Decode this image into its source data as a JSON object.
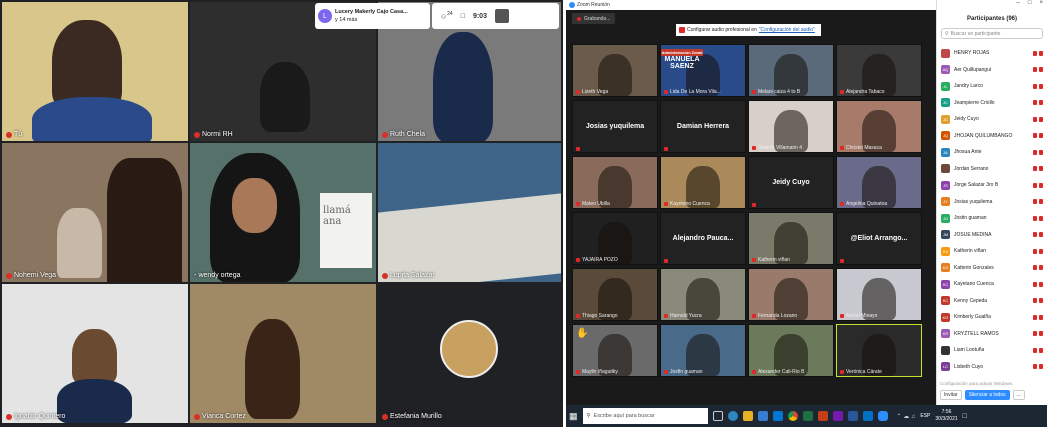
{
  "meet": {
    "notification": {
      "name": "Lucery Makerly Cajo Casa...",
      "sub": "y 14 más"
    },
    "topbar": {
      "count": "24",
      "time": "9:03"
    },
    "tiles": [
      {
        "name": "Tú",
        "bg": "#c8b87a"
      },
      {
        "name": "Normi RH",
        "bg": "#3a3a3a"
      },
      {
        "name": "Ruth Chela",
        "bg": "#6a6a6a"
      },
      {
        "name": "Nohemi Vega",
        "bg": "#7a6a5a"
      },
      {
        "name": "wendy ortega",
        "bg": "#4a6a6a"
      },
      {
        "name": "Lupita Salazar",
        "bg": "#3b5a7a"
      },
      {
        "name": "Ignacio Quintero",
        "bg": "#dcdcdc"
      },
      {
        "name": "Vianca Cortez",
        "bg": "#8a7a60"
      },
      {
        "name": "Estefania Murillo",
        "bg": "#202124"
      }
    ],
    "whiteboard_text": "llamá ana"
  },
  "zoom": {
    "title": "Zoom Reunión",
    "recording": "Grabando...",
    "banner_pre": "Configurar audio profesional en ",
    "banner_link": "\"Configuración del audio\"",
    "sign": {
      "line1": "Administración Zonal",
      "line2": "MANUELA",
      "line3": "SAENZ"
    },
    "tiles": [
      {
        "label": "Lizeth Vega",
        "video": true,
        "bg": "#6b5b4b"
      },
      {
        "label": "Lida De La Mora Vila...",
        "video": true,
        "bg": "#2a4b8a"
      },
      {
        "label": "Melani caiza 4 to B",
        "video": true,
        "bg": "#5a6a7a"
      },
      {
        "label": "Alejandra Tabaco",
        "video": true,
        "bg": "#3a3a3a"
      },
      {
        "label": "",
        "big": "Josias yuquilema"
      },
      {
        "label": "",
        "big": "Damian Herrera"
      },
      {
        "label": "Sharick Villamarin 4",
        "video": true,
        "bg": "#d8d0c8"
      },
      {
        "label": "Christel Masaca",
        "video": true,
        "bg": "#a87a6a"
      },
      {
        "label": "Mateo Ubilla",
        "video": true,
        "bg": "#8a6a5a"
      },
      {
        "label": "Kayetano Cuenca",
        "video": true,
        "bg": "#aa8a5a"
      },
      {
        "label": "",
        "big": "Jeidy  Cuyo"
      },
      {
        "label": "Angelina Quinatoa",
        "video": true,
        "bg": "#6a6a8a"
      },
      {
        "label": "YAJAIRA POZO",
        "video": true,
        "bg": "#202020"
      },
      {
        "label": "",
        "big": "Alejandro  Pauca..."
      },
      {
        "label": "Katherin viñan",
        "video": true,
        "bg": "#7a7a6a"
      },
      {
        "label": "",
        "big": "@Eliot  Arrango..."
      },
      {
        "label": "Thiago Sarango",
        "video": true,
        "bg": "#5a4a3a"
      },
      {
        "label": "Harnold Yucra",
        "video": true,
        "bg": "#8a8a7a"
      },
      {
        "label": "Fernanda Lozano",
        "video": true,
        "bg": "#9a7a6a"
      },
      {
        "label": "Ainhel Minayo",
        "video": true,
        "bg": "#c8c8d0"
      },
      {
        "label": "Maylin Iñaguitky",
        "video": true,
        "bg": "#6a6a6a",
        "thumb": true
      },
      {
        "label": "Josfin guaman",
        "video": true,
        "bg": "#4a6a8a"
      },
      {
        "label": "Alexander Cali-Rio B",
        "video": true,
        "bg": "#6a7a5a"
      },
      {
        "label": "Verónica Cárate",
        "video": true,
        "bg": "#2a2a2a",
        "active": true
      }
    ]
  },
  "participants": {
    "title": "Participantes (96)",
    "search_placeholder": "Buscar un participante",
    "list": [
      {
        "initials": "",
        "name": "HENRY ROJAS",
        "color": "#c04848",
        "photo": true
      },
      {
        "initials": "AQ",
        "name": "Aer Quillupangui",
        "color": "#9b59b6"
      },
      {
        "initials": "JL",
        "name": "Jandry Larco",
        "color": "#27ae60"
      },
      {
        "initials": "JC",
        "name": "Jeampierre Criollo",
        "color": "#16a085"
      },
      {
        "initials": "JC",
        "name": "Jeidy  Cuyo",
        "color": "#e0a030"
      },
      {
        "initials": "JQ",
        "name": "JHOJAN  QUILUMBANGO",
        "color": "#d35400"
      },
      {
        "initials": "JA",
        "name": "Jhosua Ante",
        "color": "#2e86c1"
      },
      {
        "initials": "",
        "name": "Jordan Serrano",
        "color": "#6a4a3a",
        "photo": true
      },
      {
        "initials": "JS",
        "name": "Jorge Salazar 3ro B",
        "color": "#8e44ad"
      },
      {
        "initials": "JY",
        "name": "Josias yuquilema",
        "color": "#e67e22"
      },
      {
        "initials": "JG",
        "name": "Jostin guaman",
        "color": "#27ae60"
      },
      {
        "initials": "JM",
        "name": "JOSUE  MEDINA",
        "color": "#34495e"
      },
      {
        "initials": "KV",
        "name": "Katherin viñan",
        "color": "#f39c12"
      },
      {
        "initials": "KG",
        "name": "Katterin Gonzales",
        "color": "#e67e22"
      },
      {
        "initials": "KC",
        "name": "Kayetano Cuenca",
        "color": "#8e44ad"
      },
      {
        "initials": "KC",
        "name": "Kenny Cepeda",
        "color": "#c0392b"
      },
      {
        "initials": "KG",
        "name": "Kimberly  Gualña",
        "color": "#c0392b"
      },
      {
        "initials": "KR",
        "name": "KRYZTELL RAMOS",
        "color": "#9b59b6"
      },
      {
        "initials": "",
        "name": "Liam Lootuña",
        "color": "#333333",
        "photo": true
      },
      {
        "initials": "LC",
        "name": "Lisbeth Cuyo",
        "color": "#7d3c98"
      }
    ],
    "invite": "Invitar",
    "mute_all": "Silenciar a todos",
    "more": "...",
    "watermark": "Configuración para activar Windows."
  },
  "taskbar": {
    "search": "Escribe aquí para buscar",
    "lang": "ESP",
    "time": "7:56",
    "date": "30/3/2021"
  }
}
